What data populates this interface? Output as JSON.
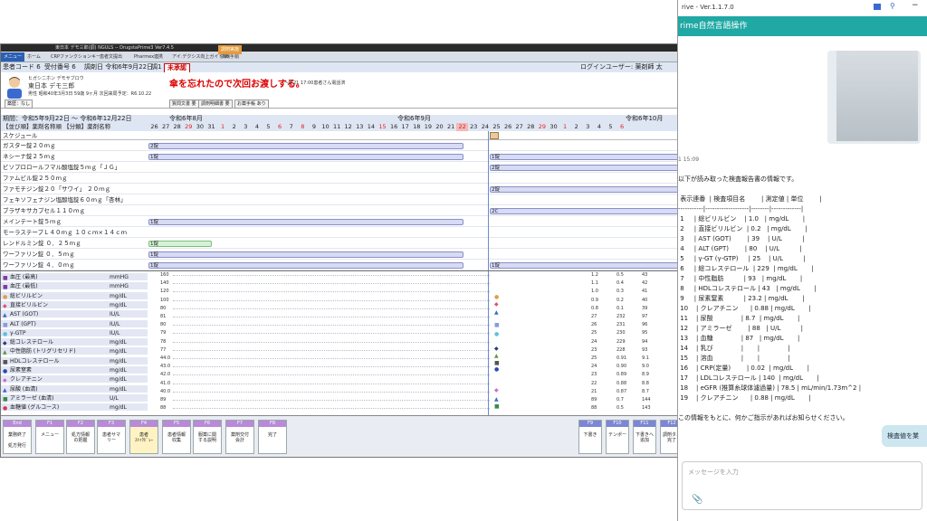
{
  "main": {
    "titlebar": {
      "left": "東日本 デモ三郎(調) NGULS -- DrugstaPrime3 Ver7.4.5",
      "right": ""
    },
    "menus": [
      "メニュー",
      "ホーム",
      "CRPファンクションキー",
      "患者文提出",
      "Pharmex連携",
      "アイ.デクシス向上ガイドNo",
      "調剤手順",
      "調剤実施"
    ],
    "patientbar": {
      "patient_code": "患者コード 6",
      "receipt_no": "受付番号 6",
      "rx_date": "調剤日 令和6年9月22日",
      "rx_kind": "調1",
      "status_badge": "未承認",
      "login_user": "ログインユーザー: 薬剤師 太"
    },
    "patient": {
      "kana": "ヒガシニホン デモサブロウ",
      "name": "東日本 デモ三郎",
      "detail": "男性 昭和40年3月3日 59歳 9ヶ月 次回来局予定：R6.10.22",
      "alert": "傘を忘れたので次回お渡しする。",
      "alert_sub": "～6-21 17:00患者さん電話済",
      "tag_left": "薬歴：なし",
      "tags": [
        "質問文書 要",
        "調剤明細書 要",
        "お薬手帳 あり"
      ]
    },
    "period": {
      "range": "期間：令和5年9月22日 ～ 令和6年12月22日",
      "months": [
        "令和6年8月",
        "令和6年9月",
        "令和6年10月"
      ]
    },
    "drug_header": "【並び順】薬剤名称順 【分類】薬剤名称",
    "days": [
      "26",
      "27",
      "28",
      "29",
      "30",
      "31",
      "1",
      "2",
      "3",
      "4",
      "5",
      "6",
      "7",
      "8",
      "9",
      "10",
      "11",
      "12",
      "13",
      "14",
      "15",
      "16",
      "17",
      "18",
      "19",
      "20",
      "21",
      "22",
      "23",
      "24",
      "25",
      "26",
      "27",
      "28",
      "29",
      "30",
      "1",
      "2",
      "3",
      "4",
      "5",
      "6"
    ],
    "schedule_label": "スケジュール",
    "drugs": [
      {
        "name": "ガスター錠２０ｍｇ",
        "bars": [
          {
            "label": "2錠",
            "green": false
          }
        ]
      },
      {
        "name": "ネシーナ錠２５ｍｇ",
        "bars": [
          {
            "label": "1錠",
            "green": false
          },
          {
            "label": "1錠",
            "green": false
          }
        ]
      },
      {
        "name": "ビソプロロールフマル酸塩錠５ｍｇ「ＪＧ」",
        "bars": [
          {
            "label": "2錠",
            "green": false
          }
        ]
      },
      {
        "name": "ファムビル錠２５０ｍｇ",
        "bars": []
      },
      {
        "name": "ファモチジン錠２０「サワイ」 ２０ｍｇ",
        "bars": [
          {
            "label": "2錠",
            "green": false
          }
        ]
      },
      {
        "name": "フェキソフェナジン塩酸塩錠６０ｍｇ「杏林」",
        "bars": []
      },
      {
        "name": "ブラザキサカプセル１１０ｍｇ",
        "bars": [
          {
            "label": "2C",
            "green": false
          }
        ]
      },
      {
        "name": "メインテート錠５ｍｇ",
        "bars": [
          {
            "label": "1錠",
            "green": false
          }
        ]
      },
      {
        "name": "モーラステープＬ４０ｍｇ １０ｃｍ×１４ｃｍ",
        "bars": []
      },
      {
        "name": "レンドルミン錠 ０．２５ｍｇ",
        "bars": [
          {
            "label": "1錠",
            "green": true
          }
        ]
      },
      {
        "name": "ワーファリン錠 ０．５ｍｇ",
        "bars": [
          {
            "label": "1錠",
            "green": false
          }
        ]
      },
      {
        "name": "ワーファリン錠 ４．０ｍｇ",
        "bars": [
          {
            "label": "1錠",
            "green": false
          },
          {
            "label": "1錠",
            "green": false
          }
        ]
      }
    ],
    "labs": [
      {
        "mark": "■",
        "color": "#7a3ca0",
        "name": "血圧 (最高)",
        "unit": "mmHG"
      },
      {
        "mark": "■",
        "color": "#7a3ca0",
        "name": "血圧 (最低)",
        "unit": "mmHG"
      },
      {
        "mark": "●",
        "color": "#e0a040",
        "name": "総ビリルビン",
        "unit": "mg/dL"
      },
      {
        "mark": "◆",
        "color": "#e0507a",
        "name": "直接ビリルビン",
        "unit": "mg/dL"
      },
      {
        "mark": "▲",
        "color": "#3a6ad0",
        "name": "AST (GOT)",
        "unit": "IU/L"
      },
      {
        "mark": "■",
        "color": "#8a9ad8",
        "name": "ALT (GPT)",
        "unit": "IU/L"
      },
      {
        "mark": "●",
        "color": "#5ac0e0",
        "name": "γ-GTP",
        "unit": "IU/L"
      },
      {
        "mark": "◆",
        "color": "#2a3a7a",
        "name": "総コレステロール",
        "unit": "mg/dL"
      },
      {
        "mark": "▲",
        "color": "#5a9a3a",
        "name": "中性脂肪 (トリグリセリド)",
        "unit": "mg/dL"
      },
      {
        "mark": "■",
        "color": "#555555",
        "name": "HDLコレステロール",
        "unit": "mg/dL"
      },
      {
        "mark": "●",
        "color": "#2a4ab0",
        "name": "尿素窒素",
        "unit": "mg/dL"
      },
      {
        "mark": "◆",
        "color": "#d06ad0",
        "name": "クレアチニン",
        "unit": "mg/dL"
      },
      {
        "mark": "▲",
        "color": "#3a6ad0",
        "name": "尿酸 (血清)",
        "unit": "mg/dL"
      },
      {
        "mark": "■",
        "color": "#3a8a4a",
        "name": "アミラーゼ (血清)",
        "unit": "U/L"
      },
      {
        "mark": "●",
        "color": "#d03a5a",
        "name": "血糖値 (グルコース)",
        "unit": "mg/dL"
      }
    ],
    "yticks": [
      "160",
      "140",
      "120",
      "100",
      "80",
      "81",
      "80",
      "79",
      "78",
      "77",
      "44.0",
      "43.0",
      "42.0",
      "41.0",
      "40.0",
      "89",
      "88"
    ],
    "lab_values": [
      [
        "1.2",
        "0.5",
        "43"
      ],
      [
        "1.1",
        "0.4",
        "42"
      ],
      [
        "1.0",
        "0.3",
        "41"
      ],
      [
        "0.9",
        "0.2",
        "40"
      ],
      [
        "0.8",
        "0.1",
        "39"
      ],
      [
        "27",
        "232",
        "97"
      ],
      [
        "26",
        "231",
        "96"
      ],
      [
        "25",
        "230",
        "95"
      ],
      [
        "24",
        "229",
        "94"
      ],
      [
        "23",
        "228",
        "93"
      ],
      [
        "25",
        "0.91",
        "9.1"
      ],
      [
        "24",
        "0.90",
        "9.0"
      ],
      [
        "23",
        "0.89",
        "8.9"
      ],
      [
        "22",
        "0.88",
        "8.8"
      ],
      [
        "21",
        "0.87",
        "8.7"
      ],
      [
        "89",
        "0.7",
        "144"
      ],
      [
        "88",
        "0.5",
        "143"
      ]
    ],
    "fkeys": [
      {
        "key": "End",
        "label": "業務終了\n\n処方発行",
        "blue": false,
        "active": false
      },
      {
        "key": "F1",
        "label": "メニュー",
        "blue": false,
        "active": false
      },
      {
        "key": "F2",
        "label": "処方情報\nの把握",
        "blue": false,
        "active": false
      },
      {
        "key": "F3",
        "label": "患者サマ\nリー",
        "blue": false,
        "active": false
      },
      {
        "key": "F4",
        "label": "患者\nｽﾄｯｸﾋﾞｭｰ",
        "blue": false,
        "active": true
      },
      {
        "key": "F5",
        "label": "患者情報\n収集",
        "blue": false,
        "active": false
      },
      {
        "key": "F6",
        "label": "服薬に関\nする説明",
        "blue": false,
        "active": false
      },
      {
        "key": "F7",
        "label": "薬剤交付\n会計",
        "blue": false,
        "active": false
      },
      {
        "key": "F8",
        "label": "完了",
        "blue": false,
        "active": false
      },
      {
        "key": "F9",
        "label": "下書き",
        "blue": true,
        "active": false
      },
      {
        "key": "F10",
        "label": "テンポー",
        "blue": true,
        "active": false
      },
      {
        "key": "F11",
        "label": "下書きへ\n追加",
        "blue": true,
        "active": false
      },
      {
        "key": "F12",
        "label": "調剤タス\n完了",
        "blue": true,
        "active": false
      }
    ]
  },
  "chat": {
    "window_title": "rive - Ver.1.1.7.0",
    "header": "rime自然言語操作",
    "time": "1 15:09",
    "lines": [
      "以下が読み取った検査報告書の情報です。",
      "",
      " 表示連番  | 検査項目名        | 測定値 | 単位        |",
      "-----------|-------------------|--------|-------------|",
      " 1     | 総ビリルビン    | 1.0   | mg/dL       |",
      " 2     | 直接ビリルビン  | 0.2   | mg/dL       |",
      " 3     | AST (GOT)        | 39    | U/L          |",
      " 4     | ALT (GPT)        | 80    | U/L          |",
      " 5     | γ-GT (γ-GTP)     | 25    | U/L          |",
      " 6     | 総コレステロール  | 229  | mg/dL       |",
      " 7     | 中性脂肪          | 93   | mg/dL       |",
      " 8     | HDLコレステロール | 43   | mg/dL       |",
      " 9     | 尿素窒素          | 23.2 | mg/dL       |",
      " 10    | クレアチニン      | 0.88 | mg/dL       |",
      " 11    | 尿酸              | 8.7  | mg/dL       |",
      " 12    | アミラーゼ        | 88   | U/L          |",
      " 13    | 血糖              | 87   | mg/dL       |",
      " 14    | 乳び              |       |              |",
      " 15    | 溶血              |       |              |",
      " 16    | CRP(定量)        | 0.02  | mg/dL       |",
      " 17    | LDLコレステロール | 140  | mg/dL       |",
      " 18    | eGFR (推算糸球体濾過量) | 78.5 | mL/min/1.73m^2 |",
      " 19    | クレアチニン      | 0.88 | mg/dL       |",
      "",
      "この情報をもとに、何かご指示があればお知らせください。"
    ],
    "confirm_button": "検査値を業",
    "input_placeholder": "メッセージを入力"
  }
}
